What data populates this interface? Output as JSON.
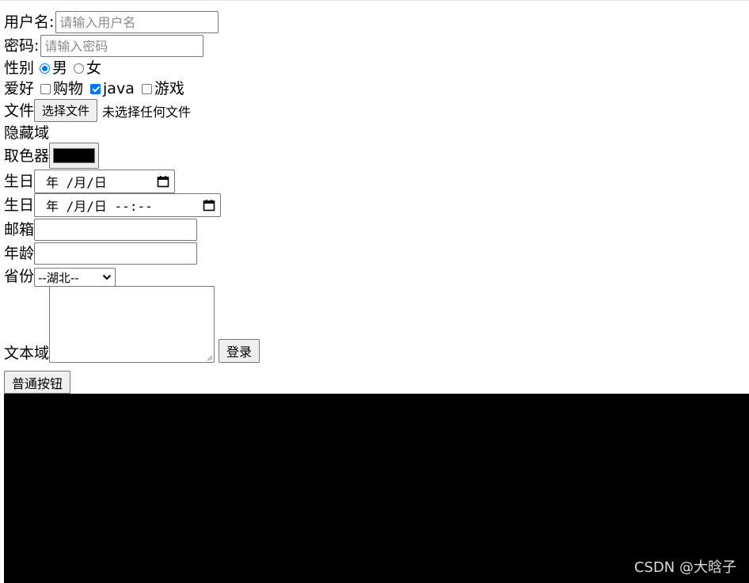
{
  "username": {
    "label": "用户名:",
    "placeholder": "请输入用户名"
  },
  "password": {
    "label": "密码:",
    "placeholder": "请输入密码"
  },
  "gender": {
    "label": "性别",
    "options": [
      "男",
      "女"
    ],
    "selected": "男"
  },
  "hobby": {
    "label": "爱好",
    "options": [
      "购物",
      "java",
      "游戏"
    ],
    "checked": [
      "java"
    ]
  },
  "file": {
    "label": "文件",
    "button": "选择文件",
    "status": "未选择任何文件"
  },
  "hidden": {
    "label": "隐藏域"
  },
  "color": {
    "label": "取色器",
    "value": "#000000"
  },
  "birth_date": {
    "label": "生日",
    "display": "年 /月/日"
  },
  "birth_datetime": {
    "label": "生日",
    "display": "年 /月/日 --:--"
  },
  "email": {
    "label": "邮箱"
  },
  "age": {
    "label": "年龄"
  },
  "province": {
    "label": "省份",
    "selected": "--湖北--"
  },
  "textarea": {
    "label": "文本域"
  },
  "buttons": {
    "login": "登录",
    "normal": "普通按钮"
  },
  "watermark": "CSDN @大晗子"
}
